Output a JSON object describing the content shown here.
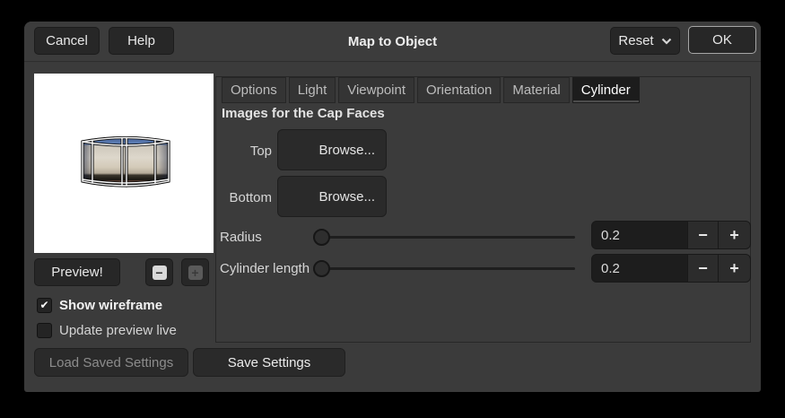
{
  "window": {
    "title": "Map to Object"
  },
  "header": {
    "cancel_label": "Cancel",
    "help_label": "Help",
    "reset_label": "Reset",
    "ok_label": "OK"
  },
  "tabs": [
    {
      "label": "Options",
      "active": false
    },
    {
      "label": "Light",
      "active": false
    },
    {
      "label": "Viewpoint",
      "active": false
    },
    {
      "label": "Orientation",
      "active": false
    },
    {
      "label": "Material",
      "active": false
    },
    {
      "label": "Cylinder",
      "active": true
    }
  ],
  "cylinder_panel": {
    "heading": "Images for the Cap Faces",
    "cap_faces": [
      {
        "label": "Top",
        "button_label": "Browse..."
      },
      {
        "label": "Bottom",
        "button_label": "Browse..."
      }
    ],
    "sliders": [
      {
        "label": "Radius",
        "value": "0.2"
      },
      {
        "label": "Cylinder length",
        "value": "0.2"
      }
    ]
  },
  "preview": {
    "button_label": "Preview!",
    "checkboxes": [
      {
        "label": "Show wireframe",
        "checked": true
      },
      {
        "label": "Update preview live",
        "checked": false
      }
    ]
  },
  "footer": {
    "load_label": "Load Saved Settings",
    "save_label": "Save Settings"
  },
  "icons": {
    "check": "✔",
    "minus": "−",
    "plus": "+",
    "chevron_down": "⌄"
  },
  "colors": {
    "dialog_bg": "#3b3b3b",
    "active_tab_bg": "#1c1c1c",
    "button_bg": "#2a2a2a",
    "entry_bg": "#1d1d1d",
    "preview_bg": "#ffffff",
    "sky": "#5578b4",
    "building": "#d8d2c6",
    "ground": "#6b4437"
  }
}
